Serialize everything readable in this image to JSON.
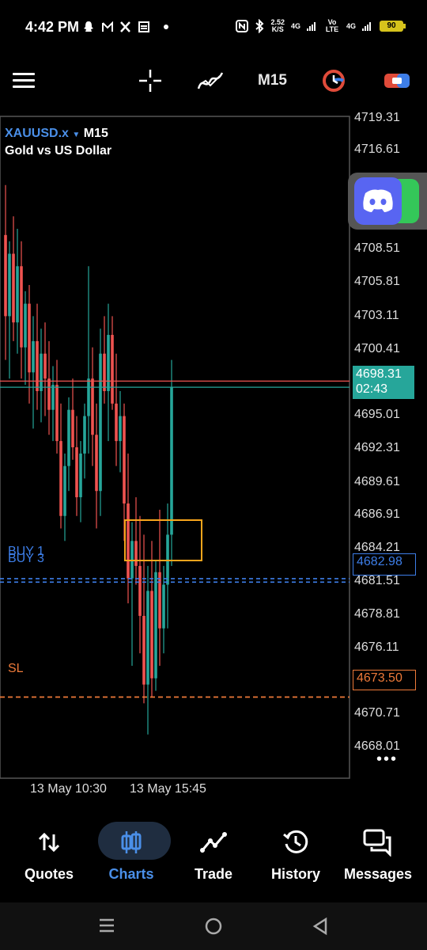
{
  "status_bar": {
    "time": "4:42 PM",
    "left_icons": [
      "snapchat-icon",
      "gmail-icon",
      "x-icon",
      "calendar-icon",
      "dot-icon"
    ],
    "net_speed_value": "2.52",
    "net_speed_unit": "K/S",
    "net1": "4G",
    "volte": "Vo LTE",
    "net2": "4G",
    "battery": "90"
  },
  "toolbar": {
    "timeframe": "M15",
    "icons": [
      "menu-icon",
      "crosshair-icon",
      "indicators-icon",
      "clock-icon",
      "toggle-icon"
    ]
  },
  "chart": {
    "symbol": "XAUUSD.x",
    "timeframe": "M15",
    "description": "Gold vs US Dollar",
    "price_ticks": [
      "4719.31",
      "4716.61",
      "4708.51",
      "4705.81",
      "4703.11",
      "4700.41",
      "4695.01",
      "4692.31",
      "4689.61",
      "4686.91",
      "4684.21",
      "4681.51",
      "4678.81",
      "4676.11",
      "4670.71",
      "4668.01"
    ],
    "time_ticks": [
      "13 May 10:30",
      "13 May 15:45"
    ],
    "current_price": "4698.31",
    "countdown": "02:43",
    "buy_label_1": "BUY 1",
    "buy_label_2": "BUY 3",
    "buy_price": "4682.98",
    "sl_label": "SL",
    "sl_price": "4673.50",
    "more": "•••",
    "colors": {
      "bull": "#26a69a",
      "bear": "#ef5350",
      "buy_line": "#3d7ee8",
      "sl_line": "#ee7a39",
      "box": "#f7a51c"
    }
  },
  "chart_data": {
    "type": "candlestick",
    "title": "XAUUSD.x M15",
    "subtitle": "Gold vs US Dollar",
    "ylim": [
      4667.0,
      4720.0
    ],
    "x_ticks": [
      "13 May 10:30",
      "13 May 15:45"
    ],
    "candles": [
      {
        "o": 4710.5,
        "h": 4714.5,
        "l": 4700.5,
        "c": 4704.0
      },
      {
        "o": 4704.0,
        "h": 4710.0,
        "l": 4699.0,
        "c": 4709.0
      },
      {
        "o": 4709.0,
        "h": 4712.0,
        "l": 4702.0,
        "c": 4703.5
      },
      {
        "o": 4703.5,
        "h": 4711.0,
        "l": 4701.0,
        "c": 4708.0
      },
      {
        "o": 4708.0,
        "h": 4710.0,
        "l": 4699.0,
        "c": 4701.5
      },
      {
        "o": 4701.5,
        "h": 4706.0,
        "l": 4698.5,
        "c": 4705.0
      },
      {
        "o": 4705.0,
        "h": 4706.5,
        "l": 4697.0,
        "c": 4699.5
      },
      {
        "o": 4699.5,
        "h": 4704.0,
        "l": 4695.0,
        "c": 4702.0
      },
      {
        "o": 4702.0,
        "h": 4705.0,
        "l": 4696.5,
        "c": 4698.0
      },
      {
        "o": 4698.0,
        "h": 4703.0,
        "l": 4695.5,
        "c": 4701.0
      },
      {
        "o": 4701.0,
        "h": 4703.5,
        "l": 4696.0,
        "c": 4699.0
      },
      {
        "o": 4699.0,
        "h": 4702.0,
        "l": 4694.5,
        "c": 4696.5
      },
      {
        "o": 4696.5,
        "h": 4700.0,
        "l": 4694.0,
        "c": 4698.5
      },
      {
        "o": 4698.5,
        "h": 4700.5,
        "l": 4693.0,
        "c": 4694.0
      },
      {
        "o": 4694.0,
        "h": 4697.0,
        "l": 4687.0,
        "c": 4688.0
      },
      {
        "o": 4688.0,
        "h": 4693.0,
        "l": 4686.0,
        "c": 4692.0
      },
      {
        "o": 4692.0,
        "h": 4697.5,
        "l": 4690.0,
        "c": 4696.5
      },
      {
        "o": 4696.5,
        "h": 4699.0,
        "l": 4692.5,
        "c": 4693.5
      },
      {
        "o": 4693.5,
        "h": 4696.0,
        "l": 4688.0,
        "c": 4689.5
      },
      {
        "o": 4689.5,
        "h": 4694.0,
        "l": 4687.5,
        "c": 4693.0
      },
      {
        "o": 4693.0,
        "h": 4697.0,
        "l": 4691.0,
        "c": 4696.0
      },
      {
        "o": 4696.0,
        "h": 4708.0,
        "l": 4693.0,
        "c": 4699.0
      },
      {
        "o": 4699.0,
        "h": 4701.5,
        "l": 4692.0,
        "c": 4694.5
      },
      {
        "o": 4694.5,
        "h": 4697.0,
        "l": 4687.0,
        "c": 4690.0
      },
      {
        "o": 4690.0,
        "h": 4703.0,
        "l": 4688.0,
        "c": 4701.0
      },
      {
        "o": 4701.0,
        "h": 4704.0,
        "l": 4697.0,
        "c": 4698.0
      },
      {
        "o": 4698.0,
        "h": 4705.0,
        "l": 4694.0,
        "c": 4702.5
      },
      {
        "o": 4702.5,
        "h": 4704.0,
        "l": 4696.5,
        "c": 4697.0
      },
      {
        "o": 4697.0,
        "h": 4701.0,
        "l": 4692.0,
        "c": 4694.0
      },
      {
        "o": 4694.0,
        "h": 4698.0,
        "l": 4691.5,
        "c": 4696.0
      },
      {
        "o": 4696.0,
        "h": 4697.0,
        "l": 4686.0,
        "c": 4689.0
      },
      {
        "o": 4689.0,
        "h": 4693.0,
        "l": 4681.0,
        "c": 4683.0
      },
      {
        "o": 4683.0,
        "h": 4687.5,
        "l": 4676.0,
        "c": 4686.0
      },
      {
        "o": 4686.0,
        "h": 4689.5,
        "l": 4682.5,
        "c": 4684.0
      },
      {
        "o": 4684.0,
        "h": 4688.0,
        "l": 4677.0,
        "c": 4680.0
      },
      {
        "o": 4680.0,
        "h": 4686.5,
        "l": 4673.0,
        "c": 4674.5
      },
      {
        "o": 4674.5,
        "h": 4684.0,
        "l": 4670.5,
        "c": 4682.0
      },
      {
        "o": 4682.0,
        "h": 4686.0,
        "l": 4673.5,
        "c": 4675.0
      },
      {
        "o": 4675.0,
        "h": 4684.5,
        "l": 4674.0,
        "c": 4683.5
      },
      {
        "o": 4683.5,
        "h": 4688.5,
        "l": 4676.0,
        "c": 4679.0
      },
      {
        "o": 4679.0,
        "h": 4684.0,
        "l": 4677.0,
        "c": 4682.5
      },
      {
        "o": 4682.5,
        "h": 4689.0,
        "l": 4679.0,
        "c": 4686.5
      },
      {
        "o": 4686.5,
        "h": 4700.5,
        "l": 4684.0,
        "c": 4698.3
      }
    ],
    "lines": [
      {
        "name": "BUY 1",
        "price": 4682.98
      },
      {
        "name": "BUY 3",
        "price": 4682.7
      },
      {
        "name": "SL",
        "price": 4673.5
      },
      {
        "name": "bid/ask",
        "price": 4698.31
      }
    ],
    "zone_box": {
      "price_high": 4685.8,
      "price_low": 4683.3
    }
  },
  "bottom_nav": {
    "items": [
      {
        "label": "Quotes",
        "icon": "quotes-icon"
      },
      {
        "label": "Charts",
        "icon": "charts-icon",
        "active": true
      },
      {
        "label": "Trade",
        "icon": "trade-icon"
      },
      {
        "label": "History",
        "icon": "history-icon"
      },
      {
        "label": "Messages",
        "icon": "messages-icon"
      }
    ]
  },
  "overlay": {
    "bubble": "discord-icon"
  }
}
